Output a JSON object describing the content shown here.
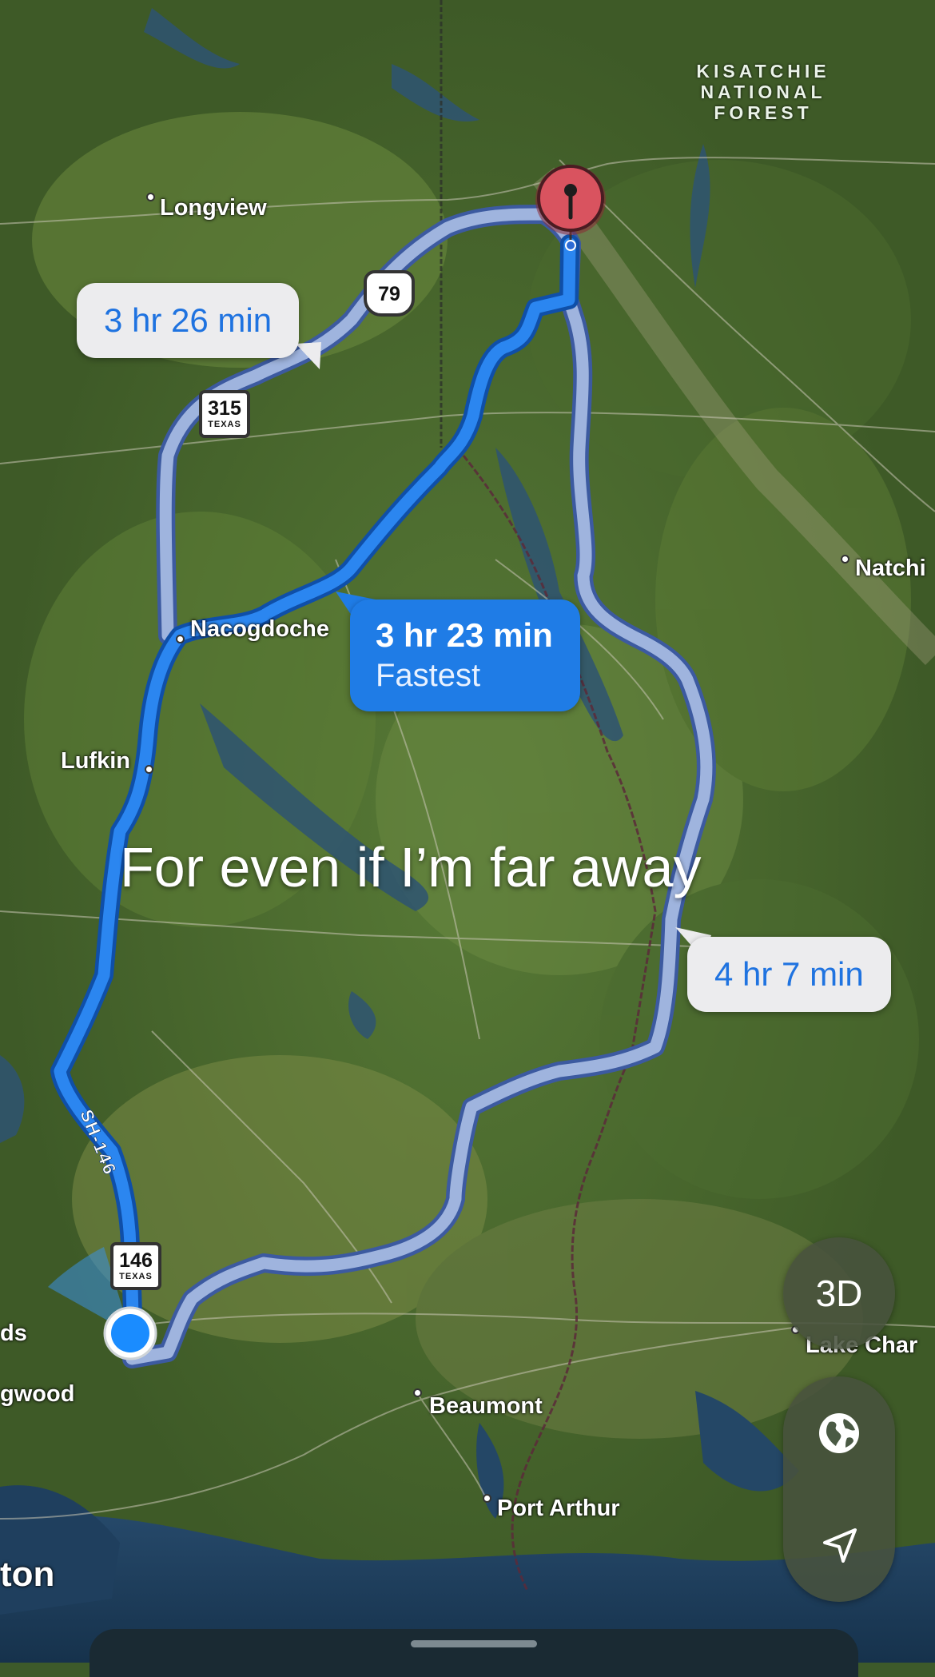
{
  "map": {
    "forest_label_lines": [
      "KISATCHIE",
      "NATIONAL",
      "FOREST"
    ],
    "cities": [
      {
        "name": "Longview"
      },
      {
        "name": "Nacogdoche"
      },
      {
        "name": "Lufkin"
      },
      {
        "name": "Natchi"
      },
      {
        "name": "Beaumont"
      },
      {
        "name": "Port Arthur"
      },
      {
        "name": "Lake Char"
      },
      {
        "name": "ds"
      },
      {
        "name": "gwood"
      },
      {
        "name": "ton"
      }
    ],
    "highway_shields": [
      {
        "number": "79",
        "kind": "us-route"
      },
      {
        "number": "315",
        "state": "TEXAS",
        "kind": "state-route"
      },
      {
        "number": "146",
        "state": "TEXAS",
        "kind": "state-route"
      }
    ],
    "road_label": "SH-146"
  },
  "routes": {
    "alt_north": {
      "time": "3 hr 26 min"
    },
    "fastest": {
      "time": "3 hr 23 min",
      "badge": "Fastest"
    },
    "alt_east": {
      "time": "4 hr 7 min"
    }
  },
  "overlay_text": "For even if I’m far away",
  "controls": {
    "view_3d_label": "3D",
    "globe_icon": "globe-icon",
    "location_icon": "location-arrow-icon"
  },
  "colors": {
    "fastest_route": "#1f7ce6",
    "alt_route": "#9fb4de",
    "destination_pin": "#d9535f",
    "user_location": "#1a8cff"
  }
}
